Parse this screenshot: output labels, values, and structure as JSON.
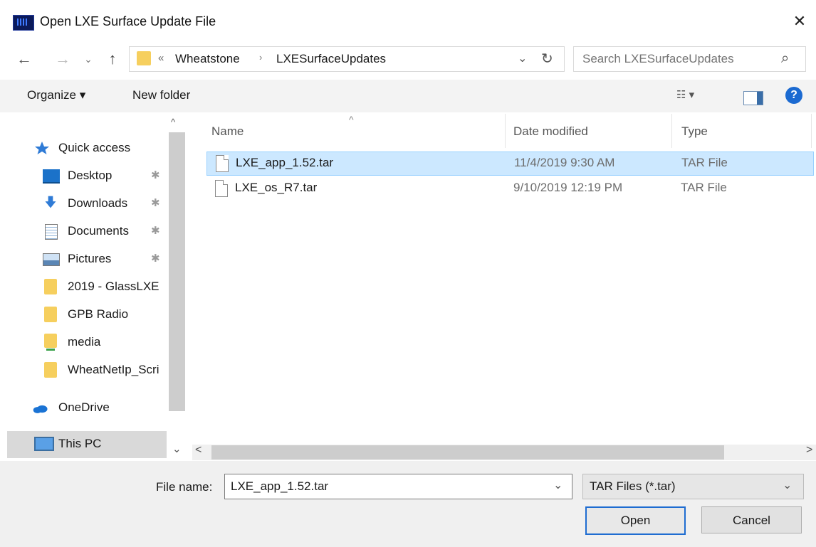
{
  "window": {
    "title": "Open LXE Surface Update File",
    "close_glyph": "✕"
  },
  "nav": {
    "back_glyph": "←",
    "forward_glyph": "→",
    "recent_glyph": "⌄",
    "up_glyph": "↑",
    "breadcrumb_overflow": "«",
    "breadcrumb": [
      "Wheatstone",
      "LXESurfaceUpdates"
    ],
    "breadcrumb_separator": "›",
    "address_dropdown_glyph": "⌄",
    "refresh_glyph": "↻",
    "search_placeholder": "Search LXESurfaceUpdates",
    "search_icon_glyph": "⌕"
  },
  "commandbar": {
    "organize_label": "Organize ▾",
    "new_folder_label": "New folder",
    "view_label": "☷ ▾",
    "help_label": "?"
  },
  "navpane": {
    "items": [
      {
        "label": "Quick access",
        "icon": "star-icon",
        "pinned": false
      },
      {
        "label": "Desktop",
        "icon": "desktop-icon",
        "pinned": true
      },
      {
        "label": "Downloads",
        "icon": "download-icon",
        "pinned": true
      },
      {
        "label": "Documents",
        "icon": "documents-icon",
        "pinned": true
      },
      {
        "label": "Pictures",
        "icon": "pictures-icon",
        "pinned": true
      },
      {
        "label": "2019 - GlassLXE",
        "icon": "folder-icon",
        "pinned": false
      },
      {
        "label": "GPB Radio",
        "icon": "folder-icon",
        "pinned": false
      },
      {
        "label": "media",
        "icon": "network-folder-icon",
        "pinned": false
      },
      {
        "label": "WheatNetIp_Scri",
        "icon": "folder-icon",
        "pinned": false
      },
      {
        "label": "OneDrive",
        "icon": "onedrive-icon",
        "pinned": false
      },
      {
        "label": "This PC",
        "icon": "computer-icon",
        "pinned": false
      }
    ],
    "pin_glyph": "✱",
    "scroll_up_glyph": "^",
    "scroll_down_glyph": "⌄"
  },
  "filelist": {
    "sort_glyph": "^",
    "columns": {
      "name": "Name",
      "date": "Date modified",
      "type": "Type"
    },
    "rows": [
      {
        "name": "LXE_app_1.52.tar",
        "date": "11/4/2019 9:30 AM",
        "type": "TAR File",
        "selected": true
      },
      {
        "name": "LXE_os_R7.tar",
        "date": "9/10/2019 12:19 PM",
        "type": "TAR File",
        "selected": false
      }
    ],
    "hscroll_left_glyph": "<",
    "hscroll_right_glyph": ">"
  },
  "bottom": {
    "filename_label": "File name:",
    "filename_value": "LXE_app_1.52.tar",
    "filename_dropdown_glyph": "⌄",
    "filetype_value": "TAR Files (*.tar)",
    "filetype_dropdown_glyph": "⌄",
    "open_label": "Open",
    "cancel_label": "Cancel"
  },
  "colors": {
    "selection_bg": "#cce8ff",
    "selection_border": "#99d1ff",
    "accent": "#1f6dd1",
    "folder": "#f6cf5e"
  }
}
